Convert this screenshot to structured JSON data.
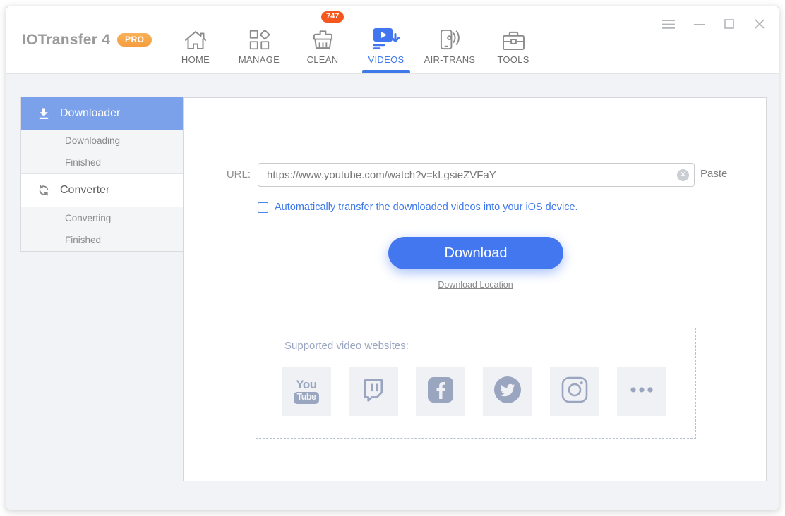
{
  "app": {
    "title": "IOTransfer 4",
    "pro_badge": "PRO"
  },
  "window_controls": {
    "icons": [
      "hamburger-menu-icon",
      "minimize-icon",
      "maximize-icon",
      "close-icon"
    ]
  },
  "nav": {
    "items": [
      {
        "label": "HOME",
        "icon": "home-icon",
        "active": false
      },
      {
        "label": "MANAGE",
        "icon": "manage-grid-icon",
        "active": false
      },
      {
        "label": "CLEAN",
        "icon": "clean-brush-icon",
        "active": false,
        "badge": "747"
      },
      {
        "label": "VIDEOS",
        "icon": "videos-download-icon",
        "active": true
      },
      {
        "label": "AIR-TRANS",
        "icon": "air-trans-phone-icon",
        "active": false
      },
      {
        "label": "TOOLS",
        "icon": "tools-briefcase-icon",
        "active": false
      }
    ]
  },
  "sidebar": {
    "groups": [
      {
        "label": "Downloader",
        "icon": "download-arrow-icon",
        "selected": true,
        "children": [
          "Downloading",
          "Finished"
        ]
      },
      {
        "label": "Converter",
        "icon": "sync-arrows-icon",
        "selected": false,
        "children": [
          "Converting",
          "Finished"
        ]
      }
    ]
  },
  "downloader": {
    "url_label": "URL:",
    "url_value": "https://www.youtube.com/watch?v=kLgsieZVFaY",
    "clear_icon": "clear-circle-x-icon",
    "clear_glyph": "✕",
    "paste_label": "Paste",
    "auto_transfer_label": "Automatically transfer the downloaded videos into your iOS device.",
    "auto_transfer_checked": false,
    "download_button_label": "Download",
    "download_location_label": "Download Location",
    "supported": {
      "title": "Supported video websites:",
      "youtube": {
        "line1": "You",
        "line2": "Tube"
      },
      "site_icons": [
        "youtube-icon",
        "twitch-icon",
        "facebook-icon",
        "twitter-icon",
        "instagram-icon",
        "more-dots-icon"
      ]
    }
  },
  "colors": {
    "accent_blue": "#3e79ea",
    "button_blue": "#4377f0",
    "sidebar_selected_blue": "#7ba1ea",
    "clean_badge_red": "#f4581f",
    "pro_badge_orange": "#f7a64a",
    "muted_site_icon": "#9aa5bf",
    "content_background": "#f2f3f7"
  }
}
